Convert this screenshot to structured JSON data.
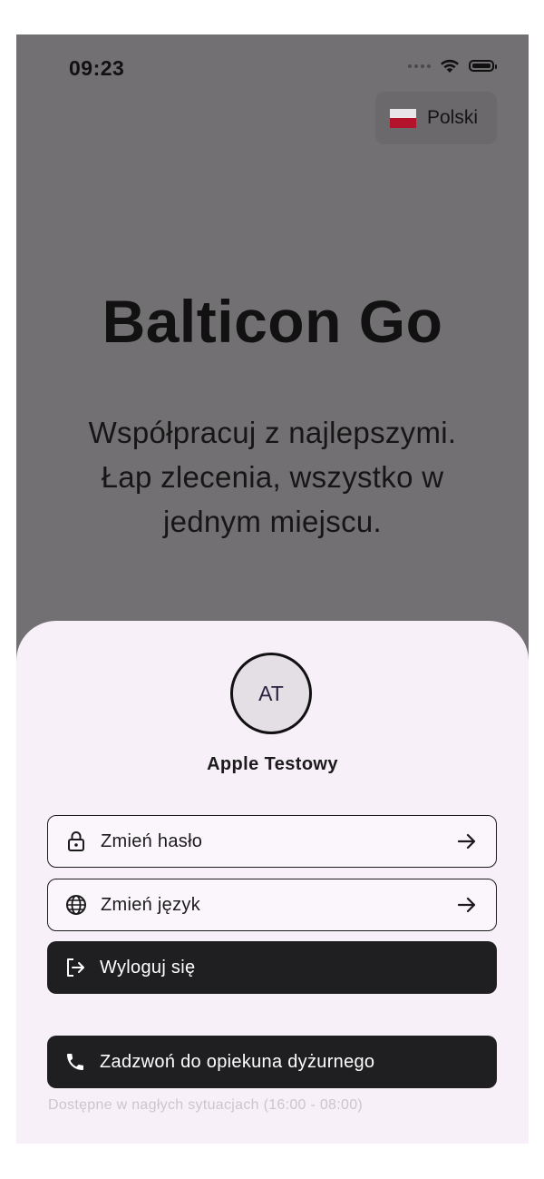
{
  "status_bar": {
    "time": "09:23"
  },
  "language_selector": {
    "label": "Polski",
    "flag": "poland-flag"
  },
  "hero": {
    "title": "Balticon Go",
    "subtitle_lines": [
      "Współpracuj z najlepszymi.",
      "Łap zlecenia, wszystko w",
      "jednym miejscu."
    ]
  },
  "profile": {
    "initials": "AT",
    "name": "Apple Testowy"
  },
  "actions": {
    "change_password": {
      "label": "Zmień hasło",
      "icon": "lock-icon"
    },
    "change_language": {
      "label": "Zmień język",
      "icon": "globe-icon"
    },
    "logout": {
      "label": "Wyloguj się",
      "icon": "logout-icon"
    },
    "call_duty": {
      "label": "Zadzwoń do opiekuna dyżurnego",
      "icon": "phone-icon"
    }
  },
  "call_note": "Dostępne w nagłych sytuacjach (16:00 - 08:00)",
  "colors": {
    "overlay_background": "#727072",
    "sheet_background": "#f7f0f8",
    "dark_button": "#1f1e21",
    "flag_red": "#b3142b"
  }
}
